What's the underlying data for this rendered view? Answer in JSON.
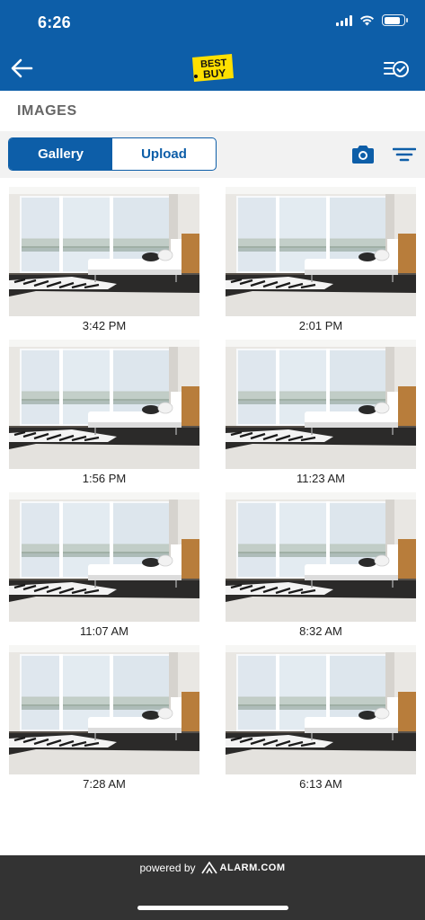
{
  "status_bar": {
    "time": "6:26",
    "battery_level": 0.85
  },
  "header": {
    "logo_text_line1": "BEST",
    "logo_text_line2": "BUY",
    "colors": {
      "bar": "#0d5ea8",
      "logo_yellow": "#ffe000"
    }
  },
  "section": {
    "title": "IMAGES"
  },
  "tabs": [
    {
      "label": "Gallery",
      "active": true
    },
    {
      "label": "Upload",
      "active": false
    }
  ],
  "toolbar_icons": [
    "camera-icon",
    "filter-icon"
  ],
  "images": [
    {
      "time": "3:42 PM"
    },
    {
      "time": "2:01 PM"
    },
    {
      "time": "1:56 PM"
    },
    {
      "time": "11:23 AM"
    },
    {
      "time": "11:07 AM"
    },
    {
      "time": "8:32 AM"
    },
    {
      "time": "7:28 AM"
    },
    {
      "time": "6:13 AM"
    }
  ],
  "footer": {
    "powered_by": "powered by",
    "brand": "ALARM.COM"
  }
}
